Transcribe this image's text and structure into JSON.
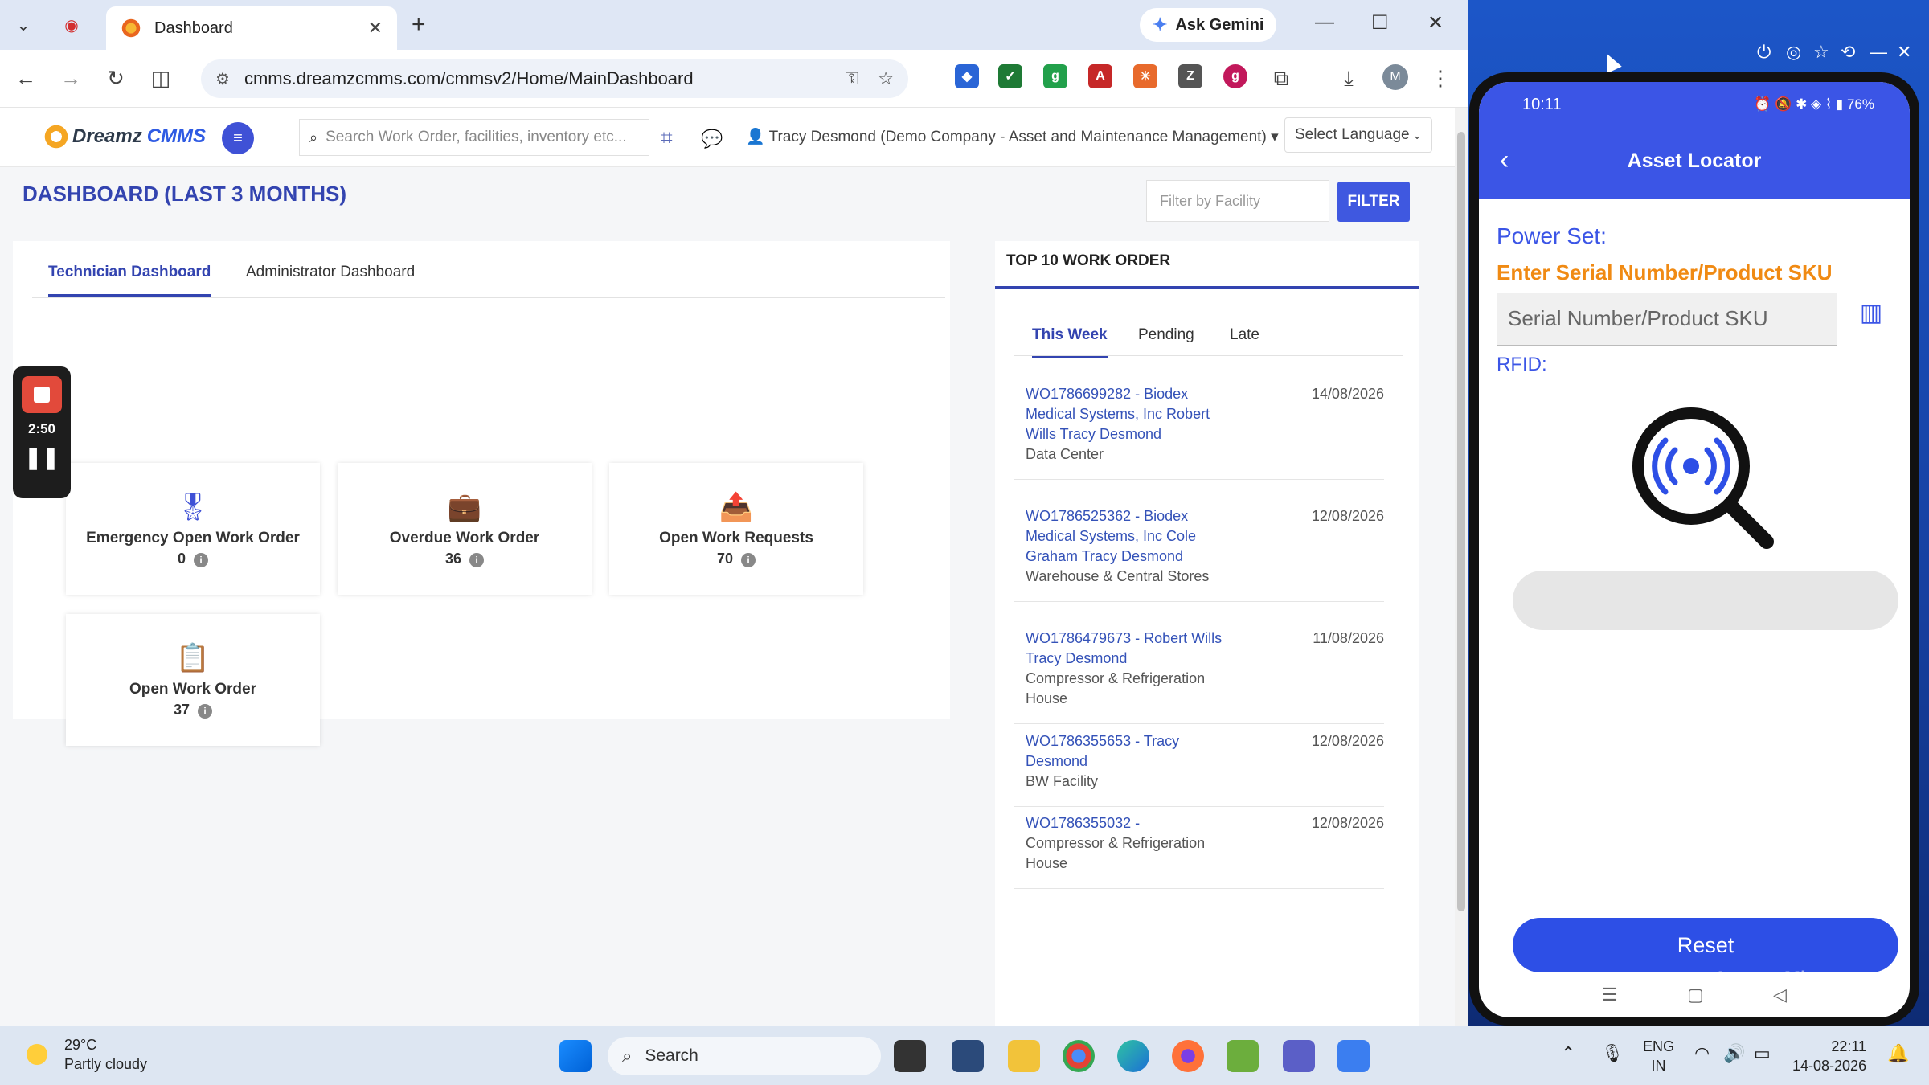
{
  "browser": {
    "tab_title": "Dashboard",
    "ask_gemini": "Ask Gemini",
    "url": "cmms.dreamzcmms.com/cmmsv2/Home/MainDashboard",
    "profile_initial": "M"
  },
  "app": {
    "logo_part1": "Dreamz",
    "logo_part2": "CMMS",
    "search_placeholder": "Search Work Order, facilities, inventory etc...",
    "user": "Tracy Desmond (Demo Company - Asset and Maintenance Management)",
    "language": "Select Language",
    "dashboard_title": "DASHBOARD (LAST 3 MONTHS)",
    "facility_placeholder": "Filter by Facility",
    "filter_label": "FILTER",
    "tabs": [
      "Technician Dashboard",
      "Administrator Dashboard"
    ],
    "cards": [
      {
        "label": "Emergency Open Work Order",
        "value": "0"
      },
      {
        "label": "Overdue Work Order",
        "value": "36"
      },
      {
        "label": "Open Work Requests",
        "value": "70"
      },
      {
        "label": "Open Work Order",
        "value": "37"
      }
    ],
    "top10": {
      "title": "TOP 10 WORK ORDER",
      "tabs": [
        "This Week",
        "Pending",
        "Late"
      ],
      "items": [
        {
          "link": "WO1786699282 - Biodex Medical Systems, Inc Robert Wills Tracy Desmond",
          "sub": "Data Center",
          "date": "14/08/2026"
        },
        {
          "link": "WO1786525362 - Biodex Medical Systems, Inc Cole Graham Tracy Desmond",
          "sub": "Warehouse & Central Stores",
          "date": "12/08/2026"
        },
        {
          "link": "WO1786479673 - Robert Wills Tracy Desmond",
          "sub": "Compressor & Refrigeration House",
          "date": "11/08/2026"
        },
        {
          "link": "WO1786355653 - Tracy Desmond",
          "sub": "BW Facility",
          "date": "12/08/2026"
        },
        {
          "link": "WO1786355032 -",
          "sub": "Compressor & Refrigeration House",
          "date": "12/08/2026"
        }
      ]
    }
  },
  "recorder": {
    "time": "2:50"
  },
  "phone": {
    "time": "10:11",
    "battery": "76%",
    "title": "Asset Locator",
    "power_set": "Power Set:",
    "enter_label": "Enter Serial Number/Product SKU",
    "sku_placeholder": "Serial Number/Product SKU",
    "rfid_label": "RFID:",
    "reset_label": "Reset",
    "watermark": "ApowerMirror"
  },
  "taskbar": {
    "temp": "29°C",
    "weather": "Partly cloudy",
    "search": "Search",
    "lang1": "ENG",
    "lang2": "IN",
    "time": "22:11",
    "date": "14-08-2026"
  },
  "colors": {
    "accent": "#3344b0",
    "phone_primary": "#3b55e6",
    "orange": "#f08a13"
  }
}
